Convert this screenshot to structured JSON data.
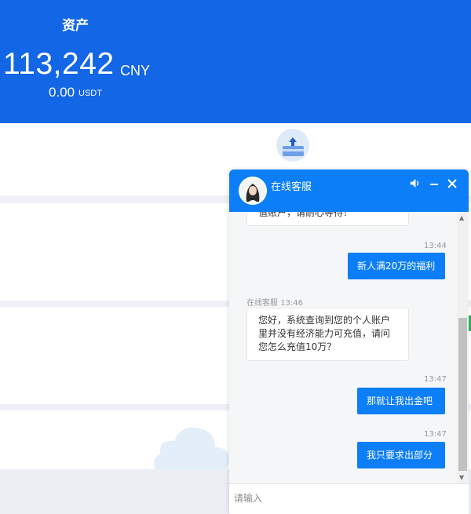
{
  "header": {
    "title": "资产",
    "amount": "113,242",
    "amount_unit": "CNY",
    "sub_amount": "0.00",
    "sub_unit": "USDT",
    "bg_color": "#1366e6"
  },
  "icons": {
    "deposit": "deposit-card-upload-icon",
    "cloud": "cloud-illustration"
  },
  "chat": {
    "title": "在线客服",
    "header_color": "#0c7ef7",
    "icons": [
      "speaker-icon",
      "minimize-icon",
      "close-icon"
    ],
    "messages": [
      {
        "from": "agent",
        "text": "值账户，请耐心等待！",
        "partial": true
      },
      {
        "from": "user",
        "time": "13:44",
        "text": "新人满20万的福利"
      },
      {
        "from": "agent",
        "sender": "在线客服",
        "time": "13:46",
        "lines": [
          "您好，系统查询到您的个人账户",
          "里并没有经济能力可充值，请问",
          "您怎么充值10万？"
        ]
      },
      {
        "from": "user",
        "time": "13:47",
        "text": "那就让我出金吧"
      },
      {
        "from": "user",
        "time": "13:47",
        "text": "我只要求出部分"
      }
    ],
    "input_placeholder": "请输入"
  }
}
